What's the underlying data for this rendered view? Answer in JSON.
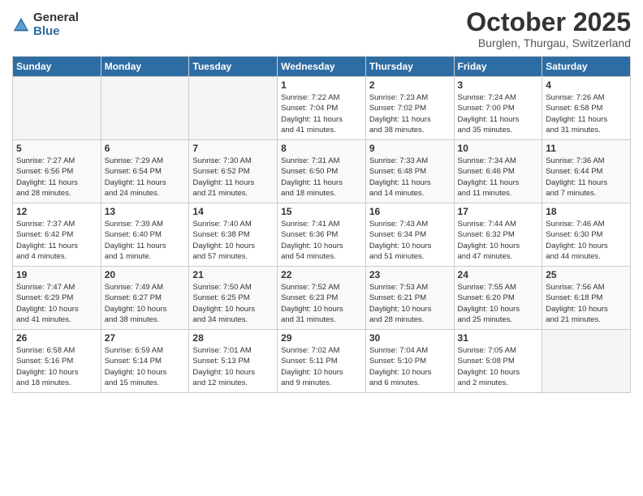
{
  "header": {
    "logo_general": "General",
    "logo_blue": "Blue",
    "month_title": "October 2025",
    "location": "Burglen, Thurgau, Switzerland"
  },
  "days_of_week": [
    "Sunday",
    "Monday",
    "Tuesday",
    "Wednesday",
    "Thursday",
    "Friday",
    "Saturday"
  ],
  "weeks": [
    [
      {
        "day": "",
        "info": ""
      },
      {
        "day": "",
        "info": ""
      },
      {
        "day": "",
        "info": ""
      },
      {
        "day": "1",
        "info": "Sunrise: 7:22 AM\nSunset: 7:04 PM\nDaylight: 11 hours\nand 41 minutes."
      },
      {
        "day": "2",
        "info": "Sunrise: 7:23 AM\nSunset: 7:02 PM\nDaylight: 11 hours\nand 38 minutes."
      },
      {
        "day": "3",
        "info": "Sunrise: 7:24 AM\nSunset: 7:00 PM\nDaylight: 11 hours\nand 35 minutes."
      },
      {
        "day": "4",
        "info": "Sunrise: 7:26 AM\nSunset: 6:58 PM\nDaylight: 11 hours\nand 31 minutes."
      }
    ],
    [
      {
        "day": "5",
        "info": "Sunrise: 7:27 AM\nSunset: 6:56 PM\nDaylight: 11 hours\nand 28 minutes."
      },
      {
        "day": "6",
        "info": "Sunrise: 7:29 AM\nSunset: 6:54 PM\nDaylight: 11 hours\nand 24 minutes."
      },
      {
        "day": "7",
        "info": "Sunrise: 7:30 AM\nSunset: 6:52 PM\nDaylight: 11 hours\nand 21 minutes."
      },
      {
        "day": "8",
        "info": "Sunrise: 7:31 AM\nSunset: 6:50 PM\nDaylight: 11 hours\nand 18 minutes."
      },
      {
        "day": "9",
        "info": "Sunrise: 7:33 AM\nSunset: 6:48 PM\nDaylight: 11 hours\nand 14 minutes."
      },
      {
        "day": "10",
        "info": "Sunrise: 7:34 AM\nSunset: 6:46 PM\nDaylight: 11 hours\nand 11 minutes."
      },
      {
        "day": "11",
        "info": "Sunrise: 7:36 AM\nSunset: 6:44 PM\nDaylight: 11 hours\nand 7 minutes."
      }
    ],
    [
      {
        "day": "12",
        "info": "Sunrise: 7:37 AM\nSunset: 6:42 PM\nDaylight: 11 hours\nand 4 minutes."
      },
      {
        "day": "13",
        "info": "Sunrise: 7:39 AM\nSunset: 6:40 PM\nDaylight: 11 hours\nand 1 minute."
      },
      {
        "day": "14",
        "info": "Sunrise: 7:40 AM\nSunset: 6:38 PM\nDaylight: 10 hours\nand 57 minutes."
      },
      {
        "day": "15",
        "info": "Sunrise: 7:41 AM\nSunset: 6:36 PM\nDaylight: 10 hours\nand 54 minutes."
      },
      {
        "day": "16",
        "info": "Sunrise: 7:43 AM\nSunset: 6:34 PM\nDaylight: 10 hours\nand 51 minutes."
      },
      {
        "day": "17",
        "info": "Sunrise: 7:44 AM\nSunset: 6:32 PM\nDaylight: 10 hours\nand 47 minutes."
      },
      {
        "day": "18",
        "info": "Sunrise: 7:46 AM\nSunset: 6:30 PM\nDaylight: 10 hours\nand 44 minutes."
      }
    ],
    [
      {
        "day": "19",
        "info": "Sunrise: 7:47 AM\nSunset: 6:29 PM\nDaylight: 10 hours\nand 41 minutes."
      },
      {
        "day": "20",
        "info": "Sunrise: 7:49 AM\nSunset: 6:27 PM\nDaylight: 10 hours\nand 38 minutes."
      },
      {
        "day": "21",
        "info": "Sunrise: 7:50 AM\nSunset: 6:25 PM\nDaylight: 10 hours\nand 34 minutes."
      },
      {
        "day": "22",
        "info": "Sunrise: 7:52 AM\nSunset: 6:23 PM\nDaylight: 10 hours\nand 31 minutes."
      },
      {
        "day": "23",
        "info": "Sunrise: 7:53 AM\nSunset: 6:21 PM\nDaylight: 10 hours\nand 28 minutes."
      },
      {
        "day": "24",
        "info": "Sunrise: 7:55 AM\nSunset: 6:20 PM\nDaylight: 10 hours\nand 25 minutes."
      },
      {
        "day": "25",
        "info": "Sunrise: 7:56 AM\nSunset: 6:18 PM\nDaylight: 10 hours\nand 21 minutes."
      }
    ],
    [
      {
        "day": "26",
        "info": "Sunrise: 6:58 AM\nSunset: 5:16 PM\nDaylight: 10 hours\nand 18 minutes."
      },
      {
        "day": "27",
        "info": "Sunrise: 6:59 AM\nSunset: 5:14 PM\nDaylight: 10 hours\nand 15 minutes."
      },
      {
        "day": "28",
        "info": "Sunrise: 7:01 AM\nSunset: 5:13 PM\nDaylight: 10 hours\nand 12 minutes."
      },
      {
        "day": "29",
        "info": "Sunrise: 7:02 AM\nSunset: 5:11 PM\nDaylight: 10 hours\nand 9 minutes."
      },
      {
        "day": "30",
        "info": "Sunrise: 7:04 AM\nSunset: 5:10 PM\nDaylight: 10 hours\nand 6 minutes."
      },
      {
        "day": "31",
        "info": "Sunrise: 7:05 AM\nSunset: 5:08 PM\nDaylight: 10 hours\nand 2 minutes."
      },
      {
        "day": "",
        "info": ""
      }
    ]
  ]
}
